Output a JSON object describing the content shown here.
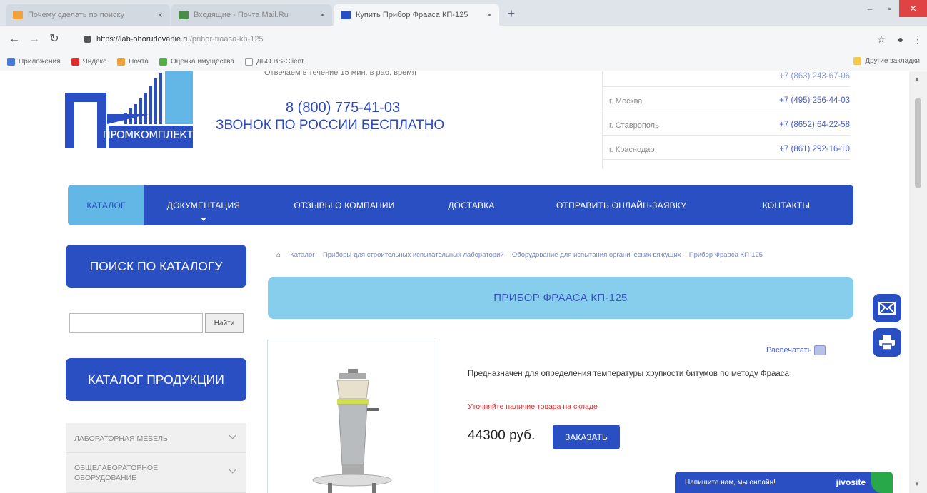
{
  "browser": {
    "tabs": [
      {
        "title": "Почему сделать по поиску",
        "icon": "mail-tab-icon",
        "color": "#f2a23a",
        "active": false
      },
      {
        "title": "Входящие - Почта Mail.Ru",
        "icon": "mailru-tab-icon",
        "color": "#4a8c4a",
        "active": false
      },
      {
        "title": "Купить Прибор Фрааса КП-125",
        "icon": "site-tab-icon",
        "color": "#2a4fc2",
        "active": true
      }
    ],
    "url_host": "https://lab-oborudovanie.ru",
    "url_path": "/pribor-fraasa-kp-125",
    "bookmarks": [
      {
        "label": "Приложения",
        "color": "#4a7ad8"
      },
      {
        "label": "Яндекс",
        "color": "#e02b2b"
      },
      {
        "label": "Почта",
        "color": "#f2a23a"
      },
      {
        "label": "Оценка имущества",
        "color": "#52b043"
      },
      {
        "label": "ДБО BS-Client",
        "color": "#999999"
      }
    ],
    "other_bookmarks": "Другие закладки"
  },
  "header": {
    "cut_text": "Отвечаем в течение 15 мин. в раб. время",
    "phone": "8 (800) 775-41-03",
    "phone_note": "ЗВОНОК ПО РОССИИ БЕСПЛАТНО",
    "first_phone": "+7 (863) 243-67-06",
    "cities": [
      {
        "name": "г. Москва",
        "phone": "+7 (495) 256-44-03"
      },
      {
        "name": "г. Ставрополь",
        "phone": "+7 (8652) 64-22-58"
      },
      {
        "name": "г. Краснодар",
        "phone": "+7 (861) 292-16-10"
      }
    ],
    "logo_text": "ПРОМКОМПЛЕКТ"
  },
  "menu": {
    "items": [
      {
        "label": "КАТАЛОГ",
        "active": true
      },
      {
        "label": "ДОКУМЕНТАЦИЯ",
        "active": false,
        "has_dropdown": true
      },
      {
        "label": "ОТЗЫВЫ О КОМПАНИИ",
        "active": false
      },
      {
        "label": "ДОСТАВКА",
        "active": false
      },
      {
        "label": "ОТПРАВИТЬ ОНЛАЙН-ЗАЯВКУ",
        "active": false
      },
      {
        "label": "КОНТАКТЫ",
        "active": false
      }
    ]
  },
  "sidebar": {
    "search_title": "ПОИСК ПО КАТАЛОГУ",
    "search_value": "",
    "search_button": "Найти",
    "catalog_title": "КАТАЛОГ ПРОДУКЦИИ",
    "categories": [
      "ЛАБОРАТОРНАЯ МЕБЕЛЬ",
      "ОБЩЕЛАБОРАТОРНОЕ ОБОРУДОВАНИЕ"
    ]
  },
  "breadcrumb": {
    "items": [
      "Каталог",
      "Приборы для строительных испытательных лабораторий",
      "Оборудование для испытания органических вяжущих",
      "Прибор Фрааса КП-125"
    ]
  },
  "product": {
    "title": "ПРИБОР ФРААСА КП-125",
    "print_label": "Распечатать",
    "description": "Предназначен для определения температуры хрупкости битумов по методу Фрааса",
    "stock_note": "Уточняйте наличие товара на складе",
    "price": "44300 руб.",
    "order_button": "ЗАКАЗАТЬ"
  },
  "chat": {
    "label": "Напишите нам, мы онлайн!",
    "brand": "jivosite"
  },
  "colors": {
    "brand_blue": "#2a4fc2",
    "light_blue": "#87ceed",
    "accent_red": "#e02b2b"
  }
}
